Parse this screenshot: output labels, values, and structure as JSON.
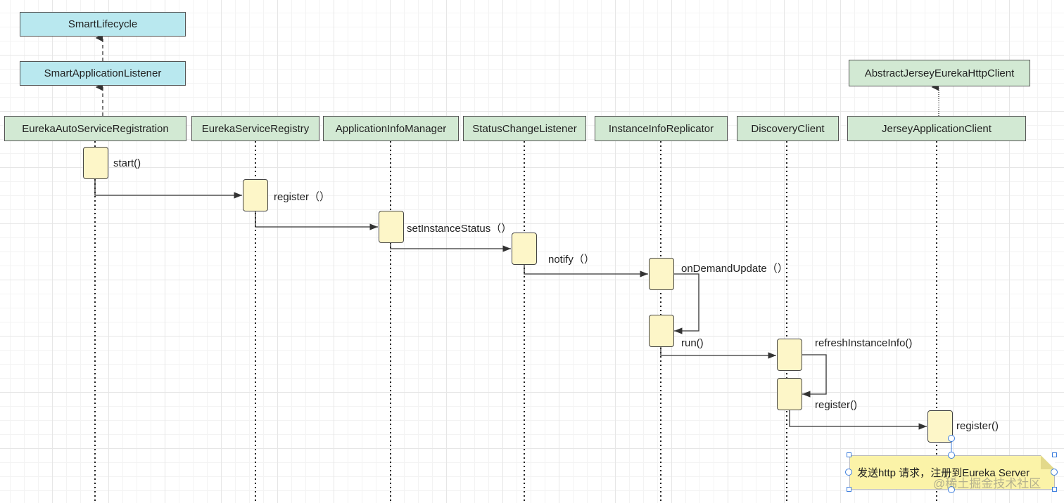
{
  "interfaces": {
    "smart_lifecycle": "SmartLifecycle",
    "smart_application_listener": "SmartApplicationListener",
    "abstract_jersey_client": "AbstractJerseyEurekaHttpClient"
  },
  "lifelines": [
    {
      "id": "eureka-auto-service-registration",
      "label": "EurekaAutoServiceRegistration"
    },
    {
      "id": "eureka-service-registry",
      "label": "EurekaServiceRegistry"
    },
    {
      "id": "application-info-manager",
      "label": "ApplicationInfoManager"
    },
    {
      "id": "status-change-listener",
      "label": "StatusChangeListener"
    },
    {
      "id": "instance-info-replicator",
      "label": "InstanceInfoReplicator"
    },
    {
      "id": "discovery-client",
      "label": "DiscoveryClient"
    },
    {
      "id": "jersey-application-client",
      "label": "JerseyApplicationClient"
    }
  ],
  "messages": {
    "start": "start()",
    "register1": "register（）",
    "set_instance_status": "setInstanceStatus（）",
    "notify": "notify（）",
    "on_demand_update": "onDemandUpdate（）",
    "run": "run()",
    "refresh_instance_info": "refreshInstanceInfo()",
    "register2": "register()",
    "register3": "register()"
  },
  "note": "发送http 请求，注册到Eureka Server",
  "watermark": "@稀土掘金技术社区",
  "colors": {
    "interface_fill": "#b9e8ef",
    "class_fill": "#d2e9d3",
    "activation_fill": "#fdf6c8",
    "note_fill": "#fbf3a8"
  }
}
